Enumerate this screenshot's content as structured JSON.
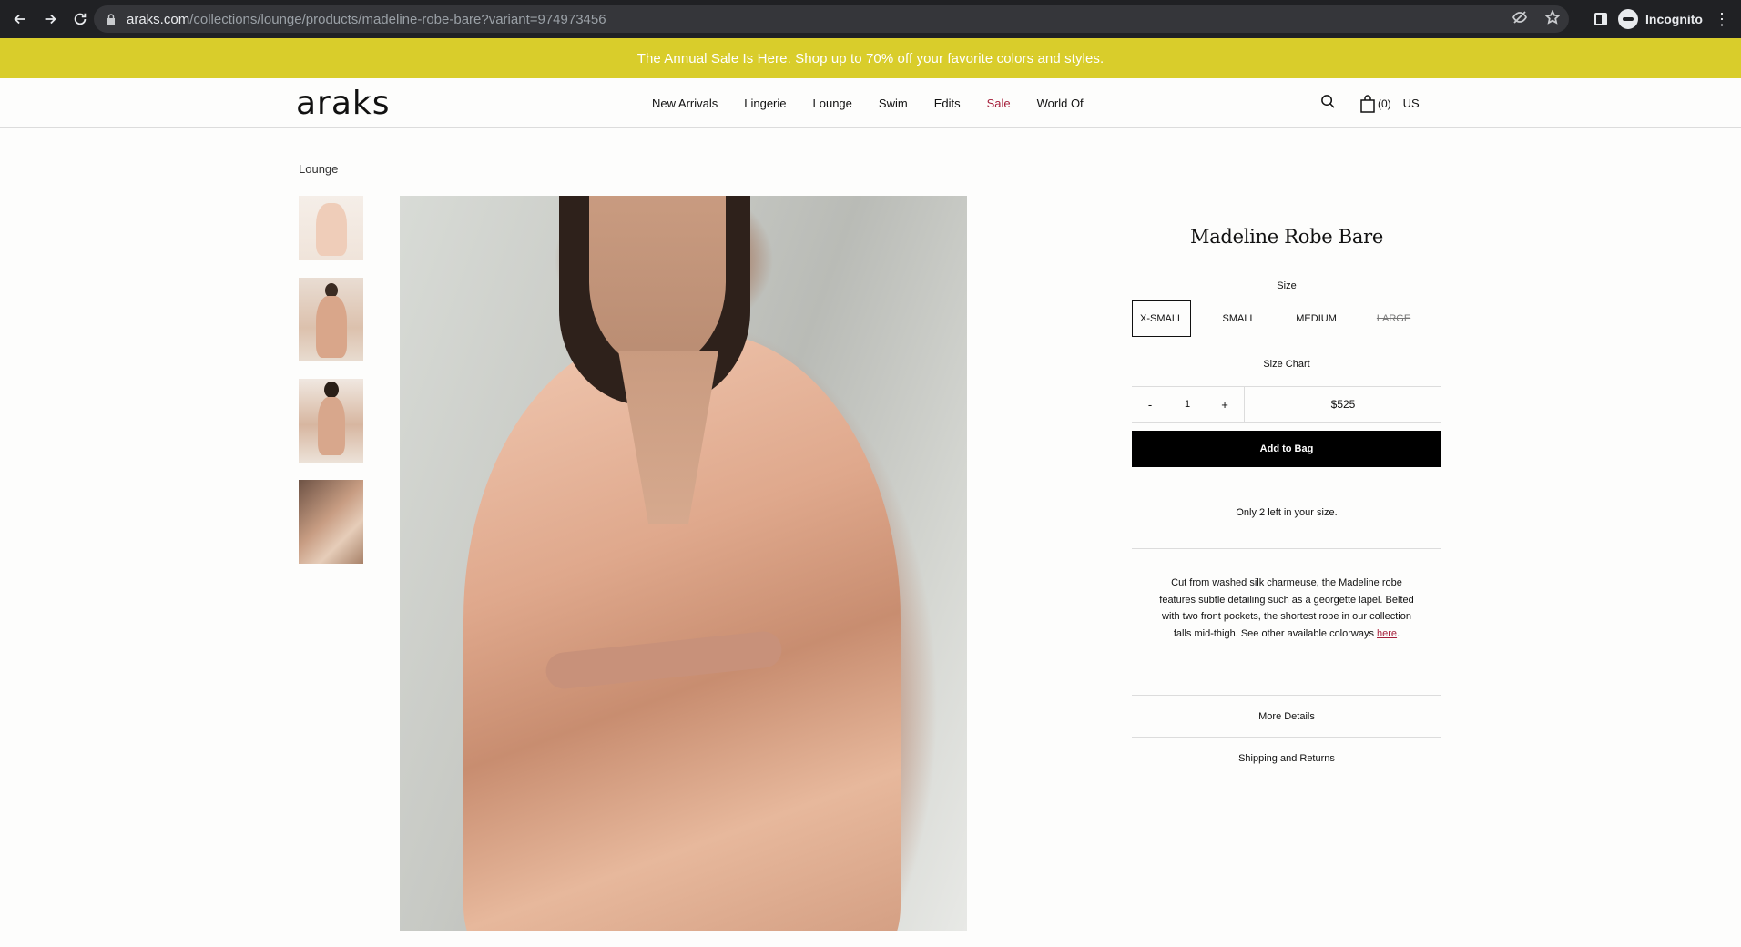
{
  "browser": {
    "url_host": "araks.com",
    "url_path": "/collections/lounge/products/madeline-robe-bare?variant=974973456",
    "profile_label": "Incognito"
  },
  "promo": {
    "text": "The Annual Sale Is Here. Shop up to 70% off your favorite colors and styles."
  },
  "header": {
    "logo": "araks",
    "nav": [
      "New Arrivals",
      "Lingerie",
      "Lounge",
      "Swim",
      "Edits",
      "Sale",
      "World Of"
    ],
    "bag_count": "(0)",
    "region": "US"
  },
  "breadcrumb": "Lounge",
  "product": {
    "title": "Madeline Robe Bare",
    "size_label": "Size",
    "sizes": [
      "X-SMALL",
      "SMALL",
      "MEDIUM",
      "LARGE"
    ],
    "size_chart": "Size Chart",
    "qty_minus": "-",
    "qty_value": "1",
    "qty_plus": "+",
    "price": "$525",
    "add_to_bag": "Add to Bag",
    "stock_note": "Only 2 left in your size.",
    "description": "Cut from washed silk charmeuse, the Madeline robe features subtle detailing such as a georgette lapel. Belted with two front pockets, the shortest robe in our collection falls mid-thigh. See other available colorways",
    "description_link": "here",
    "description_end": ".",
    "more_details": "More Details",
    "shipping": "Shipping and Returns"
  },
  "colors": {
    "promo_bg": "#d9cd2b",
    "sale_accent": "#a51f3a",
    "button_bg": "#000000"
  }
}
